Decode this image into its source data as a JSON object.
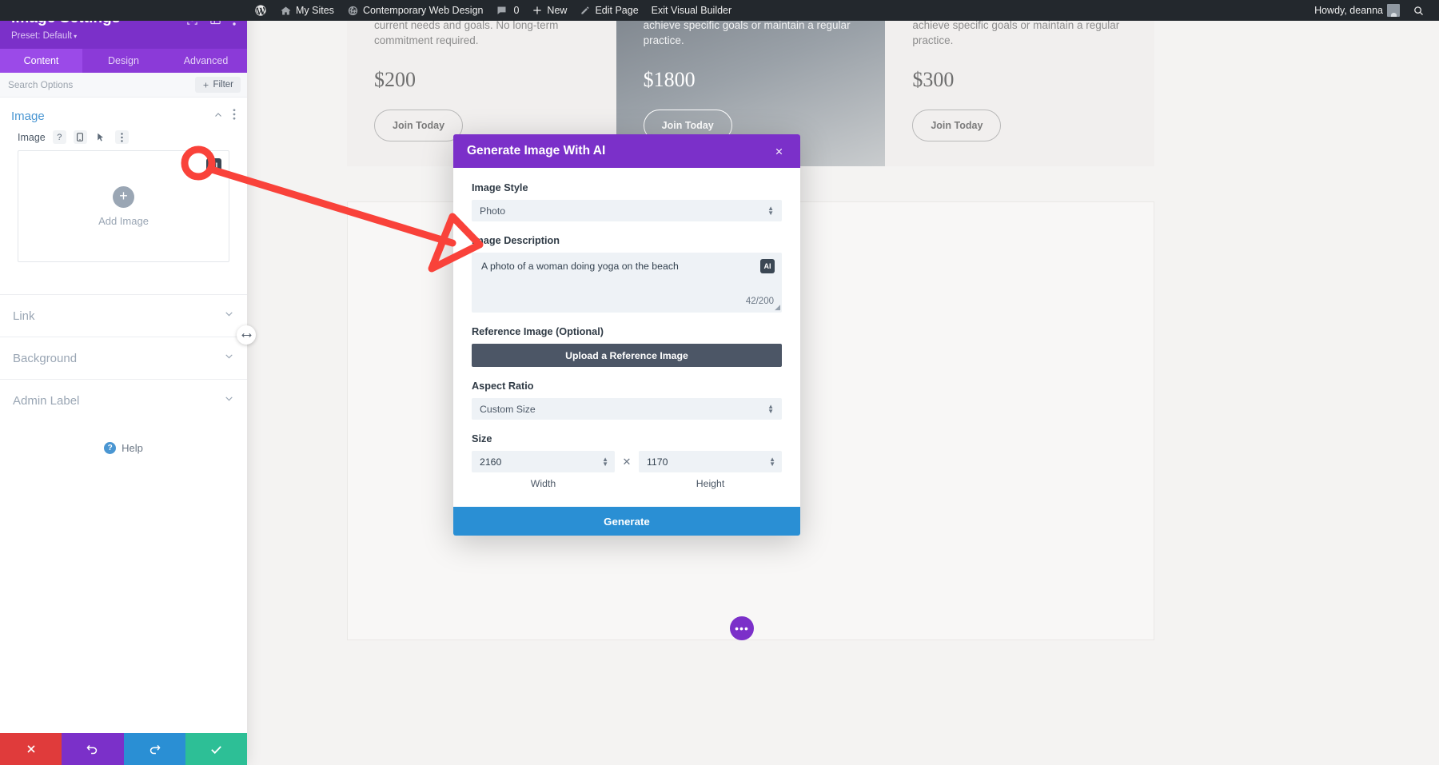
{
  "adminbar": {
    "items": [
      {
        "icon": "wordpress-logo-icon",
        "label": ""
      },
      {
        "icon": "my-sites-icon",
        "label": "My Sites"
      },
      {
        "icon": "site-icon",
        "label": "Contemporary Web Design"
      },
      {
        "icon": "comment-icon",
        "label": "0"
      },
      {
        "icon": "plus-icon",
        "label": "New"
      },
      {
        "icon": "pencil-icon",
        "label": "Edit Page"
      },
      {
        "icon": "",
        "label": "Exit Visual Builder"
      }
    ],
    "howdy": "Howdy, deanna",
    "search_icon": "search-icon"
  },
  "panel": {
    "title": "Image Settings",
    "preset": "Preset: Default",
    "header_icons": [
      "focus-target-icon",
      "layout-columns-icon",
      "kebab-menu-icon"
    ],
    "tabs": [
      {
        "label": "Content",
        "active": true
      },
      {
        "label": "Design",
        "active": false
      },
      {
        "label": "Advanced",
        "active": false
      }
    ],
    "search_placeholder": "Search Options",
    "filter_label": "Filter",
    "section": {
      "title": "Image",
      "field_label": "Image",
      "field_icons": [
        "help-icon",
        "responsive-icon",
        "hover-icon",
        "kebab-menu-icon"
      ],
      "ai_badge": "AI",
      "upload_label": "Add Image",
      "upload_plus": "+"
    },
    "accordions": [
      {
        "label": "Link"
      },
      {
        "label": "Background"
      },
      {
        "label": "Admin Label"
      }
    ],
    "help_label": "Help",
    "help_mark": "?",
    "footer_buttons": [
      {
        "name": "discard-button",
        "icon": "close-x-icon",
        "color": "#e03b3b"
      },
      {
        "name": "undo-button",
        "icon": "undo-arrow-icon",
        "color": "#7b30c9"
      },
      {
        "name": "redo-button",
        "icon": "redo-arrow-icon",
        "color": "#2a8fd4"
      },
      {
        "name": "save-button",
        "icon": "checkmark-icon",
        "color": "#2dbf96"
      }
    ],
    "resize_handle_icon": "horizontal-resize-icon"
  },
  "canvas": {
    "cards": [
      {
        "text": "personalized yoga practice tailored to your current needs and goals. No long-term commitment required.",
        "price": "$200",
        "cta": "Join Today",
        "featured": false
      },
      {
        "text": "looking to commit to a series of classes to achieve specific goals or maintain a regular practice.",
        "price": "$1800",
        "cta": "Join Today",
        "featured": true
      },
      {
        "text": "looking to commit to a series of classes to achieve specific goals or maintain a regular practice.",
        "price": "$300",
        "cta": "Join Today",
        "featured": false
      }
    ],
    "fab_icon": "more-options-icon",
    "fab_label": "•••"
  },
  "modal": {
    "title": "Generate Image With AI",
    "close_icon": "close-x-icon",
    "image_style_label": "Image Style",
    "image_style_value": "Photo",
    "image_description_label": "Image Description",
    "image_description_value": "A photo of a woman doing yoga on the beach",
    "image_description_ai_badge": "AI",
    "char_count": "42/200",
    "reference_label": "Reference Image (Optional)",
    "reference_button": "Upload a Reference Image",
    "aspect_ratio_label": "Aspect Ratio",
    "aspect_ratio_value": "Custom Size",
    "size_label": "Size",
    "width_value": "2160",
    "height_value": "1170",
    "size_separator": "✕",
    "width_label": "Width",
    "height_label": "Height",
    "generate_button": "Generate"
  },
  "annotation": {
    "highlight_color": "#f9423a",
    "circle_target": "ai-badge",
    "arrow_points_to": "image-description-field"
  }
}
